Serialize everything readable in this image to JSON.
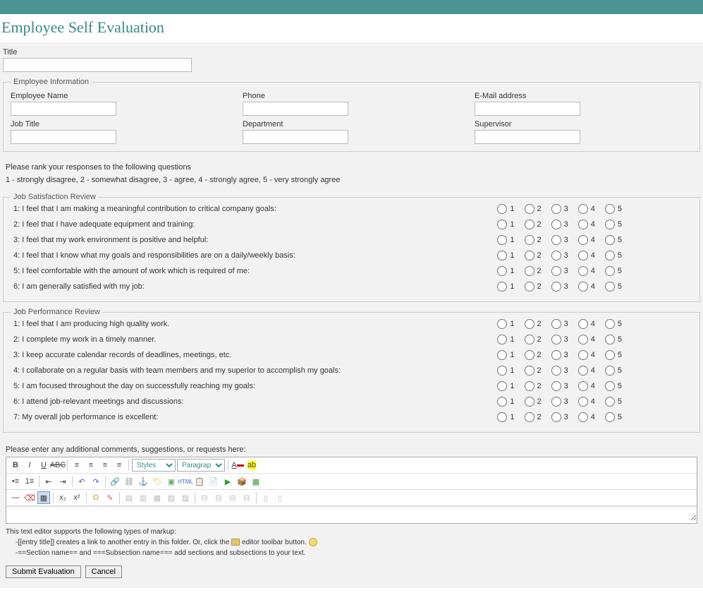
{
  "page_title": "Employee Self Evaluation",
  "title_field": {
    "label": "Title"
  },
  "employee_info": {
    "legend": "Employee Information",
    "fields": {
      "name": {
        "label": "Employee Name"
      },
      "phone": {
        "label": "Phone"
      },
      "email": {
        "label": "E-Mail address"
      },
      "job_title": {
        "label": "Job Title"
      },
      "department": {
        "label": "Department"
      },
      "supervisor": {
        "label": "Supervisor"
      }
    }
  },
  "instructions": "Please rank your responses to the following questions",
  "scale_legend": "1 - strongly disagree, 2 - somewhat disagree, 3 - agree, 4 - strongly agree, 5 - very strongly agree",
  "rating_labels": [
    "1",
    "2",
    "3",
    "4",
    "5"
  ],
  "satisfaction": {
    "legend": "Job Satisfaction Review",
    "questions": [
      "1: I feel that I am making a meaningful contribution to critical company goals:",
      "2: I feel that I have adequate equipment and training:",
      "3: I feel that my work environment is positive and helpful:",
      "4: I feel that I know what my goals and responsibilities are on a daily/weekly basis:",
      "5: I feel comfortable with the amount of work which is required of me:",
      "6: I am generally satisfied with my job:"
    ]
  },
  "performance": {
    "legend": "Job Performance Review",
    "questions": [
      "1: I feel that I am producing high quality work.",
      "2: I complete my work in a timely manner.",
      "3: I keep accurate calendar records of deadlines, meetings, etc.",
      "4: I collaborate on a regular basis with team members and my superior to accomplish my goals:",
      "5: I am focused throughout the day on successfully reaching my goals:",
      "6: I attend job-relevant meetings and discussions:",
      "7: My overall job performance is excellent:"
    ]
  },
  "comments_label": "Please enter any additional comments, suggestions, or requests here:",
  "editor": {
    "styles_label": "Styles",
    "paragraph_label": "Paragraph",
    "html_label": "HTML"
  },
  "markup_help": {
    "intro": "This text editor supports the following types of markup:",
    "line1a": "-[[entry title]] creates a link to another entry in this folder. Or, click the ",
    "line1b": " editor toolbar button. ",
    "line2": "-==Section name== and ===Subsection name=== add sections and subsections to your text."
  },
  "buttons": {
    "submit": "Submit Evaluation",
    "cancel": "Cancel"
  }
}
